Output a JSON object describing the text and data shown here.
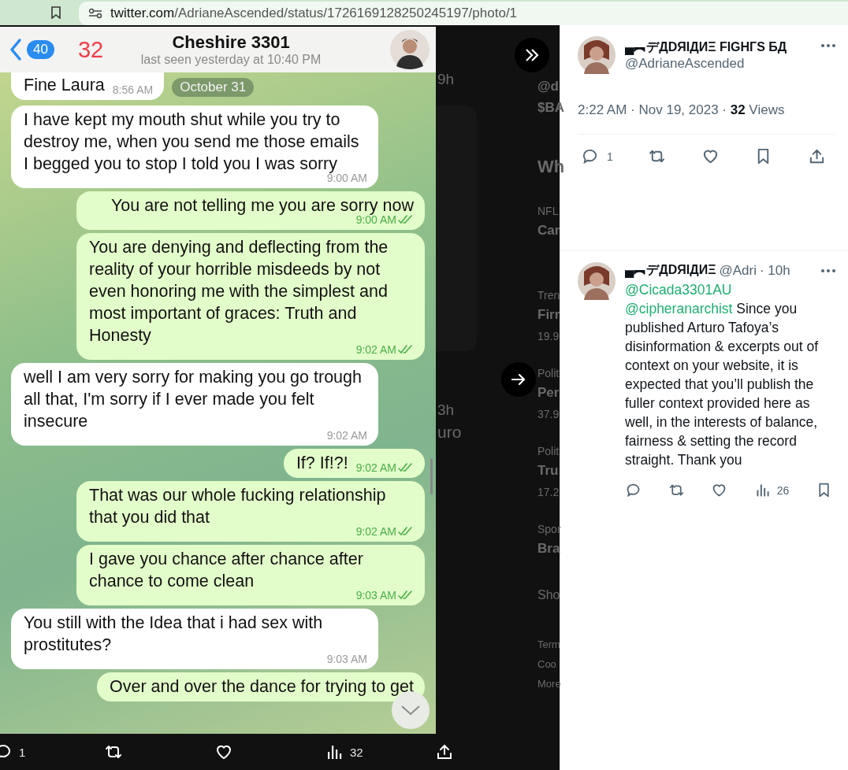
{
  "browser": {
    "url_host": "twitter.com",
    "url_path": "/AdrianeAscended/status/1726169128250245197/photo/1"
  },
  "chat": {
    "back_badge": "40",
    "unread_count": "32",
    "title": "Cheshire 3301",
    "subtitle": "last seen yesterday at 10:40 PM",
    "date_pill": "October 31",
    "messages": [
      {
        "kind": "in",
        "text": "Fine Laura",
        "time": "8:56 AM"
      },
      {
        "kind": "in",
        "text": "I have kept my mouth shut while you try to destroy me, when you send me those emails I begged you to stop I told you I was sorry",
        "time": "9:00 AM"
      },
      {
        "kind": "out",
        "text": "You are not telling me you are sorry now",
        "time": "9:00 AM",
        "read": true
      },
      {
        "kind": "out",
        "text": "You are denying and deflecting from the reality of your horrible misdeeds by not even honoring me with the simplest and most important of graces: Truth and Honesty",
        "time": "9:02 AM",
        "read": true
      },
      {
        "kind": "in",
        "text": "well I am very sorry for making you go trough all that, I'm sorry if I ever made you felt insecure",
        "time": "9:02 AM"
      },
      {
        "kind": "out",
        "text": "If? If!?!",
        "time": "9:02 AM",
        "read": true
      },
      {
        "kind": "out",
        "text": "That was our whole fucking relationship that you did that",
        "time": "9:02 AM",
        "read": true
      },
      {
        "kind": "out",
        "text": "I gave you chance after chance after chance to come clean",
        "time": "9:03 AM",
        "read": true
      },
      {
        "kind": "in",
        "text": "You still with the Idea that i had sex with prostitutes?",
        "time": "9:03 AM"
      },
      {
        "kind": "out",
        "text": "Over and over the dance for trying to get"
      }
    ]
  },
  "background_page": {
    "left_fragments": [
      {
        "kind": "age",
        "text": "9h"
      },
      {
        "kind": "age",
        "text": "3h"
      },
      {
        "kind": "body",
        "text": "uro"
      }
    ],
    "right_fragments": [
      {
        "kind": "handle",
        "text": "@d"
      },
      {
        "kind": "handle",
        "text": "$BA"
      },
      {
        "kind": "heading",
        "text": "Wh"
      },
      {
        "kind": "meta",
        "text": "NFL"
      },
      {
        "kind": "title",
        "text": "Car"
      },
      {
        "kind": "meta",
        "text": "Tren"
      },
      {
        "kind": "title",
        "text": "Firr"
      },
      {
        "kind": "count",
        "text": "19.9"
      },
      {
        "kind": "meta",
        "text": "Polit"
      },
      {
        "kind": "title",
        "text": "Per"
      },
      {
        "kind": "count",
        "text": "37.9"
      },
      {
        "kind": "meta",
        "text": "Polit"
      },
      {
        "kind": "title",
        "text": "Tru"
      },
      {
        "kind": "count",
        "text": "17.2"
      },
      {
        "kind": "meta",
        "text": "Spor"
      },
      {
        "kind": "title",
        "text": "Bra"
      },
      {
        "kind": "link",
        "text": "Sho"
      },
      {
        "kind": "foot",
        "text": "Term"
      },
      {
        "kind": "foot",
        "text": "Coo"
      },
      {
        "kind": "foot",
        "text": "More"
      }
    ]
  },
  "photo_actions": [
    {
      "kind": "reply",
      "count": "1"
    },
    {
      "kind": "retweet"
    },
    {
      "kind": "like"
    },
    {
      "kind": "views",
      "count": "32"
    },
    {
      "kind": "share"
    }
  ],
  "tweet": {
    "name": "▄︻デДDЯIДИΞ FIGHГS БД",
    "handle": "@AdrianeAscended",
    "meta": "2:22 AM · Nov 19, 2023 · **32** Views",
    "actions": [
      {
        "kind": "reply",
        "count": "1"
      },
      {
        "kind": "retweet"
      },
      {
        "kind": "like"
      },
      {
        "kind": "bookmark"
      },
      {
        "kind": "share"
      }
    ]
  },
  "reply": {
    "name": "▄︻デДDЯIДИΞ",
    "handle": "@Adri",
    "age": "· 10h",
    "mentions": [
      "@Cicada3301AU",
      "@cipheranarchist"
    ],
    "text": "Since you published Arturo Tafoya’s disinformation & excerpts out of context on your website, it is expected that you’ll publish the fuller context provided here as well, in the interests of balance, fairness & setting the record straight. Thank you",
    "actions": [
      {
        "kind": "reply"
      },
      {
        "kind": "retweet"
      },
      {
        "kind": "like"
      },
      {
        "kind": "views",
        "count": "26"
      },
      {
        "kind": "bookmark"
      }
    ]
  }
}
